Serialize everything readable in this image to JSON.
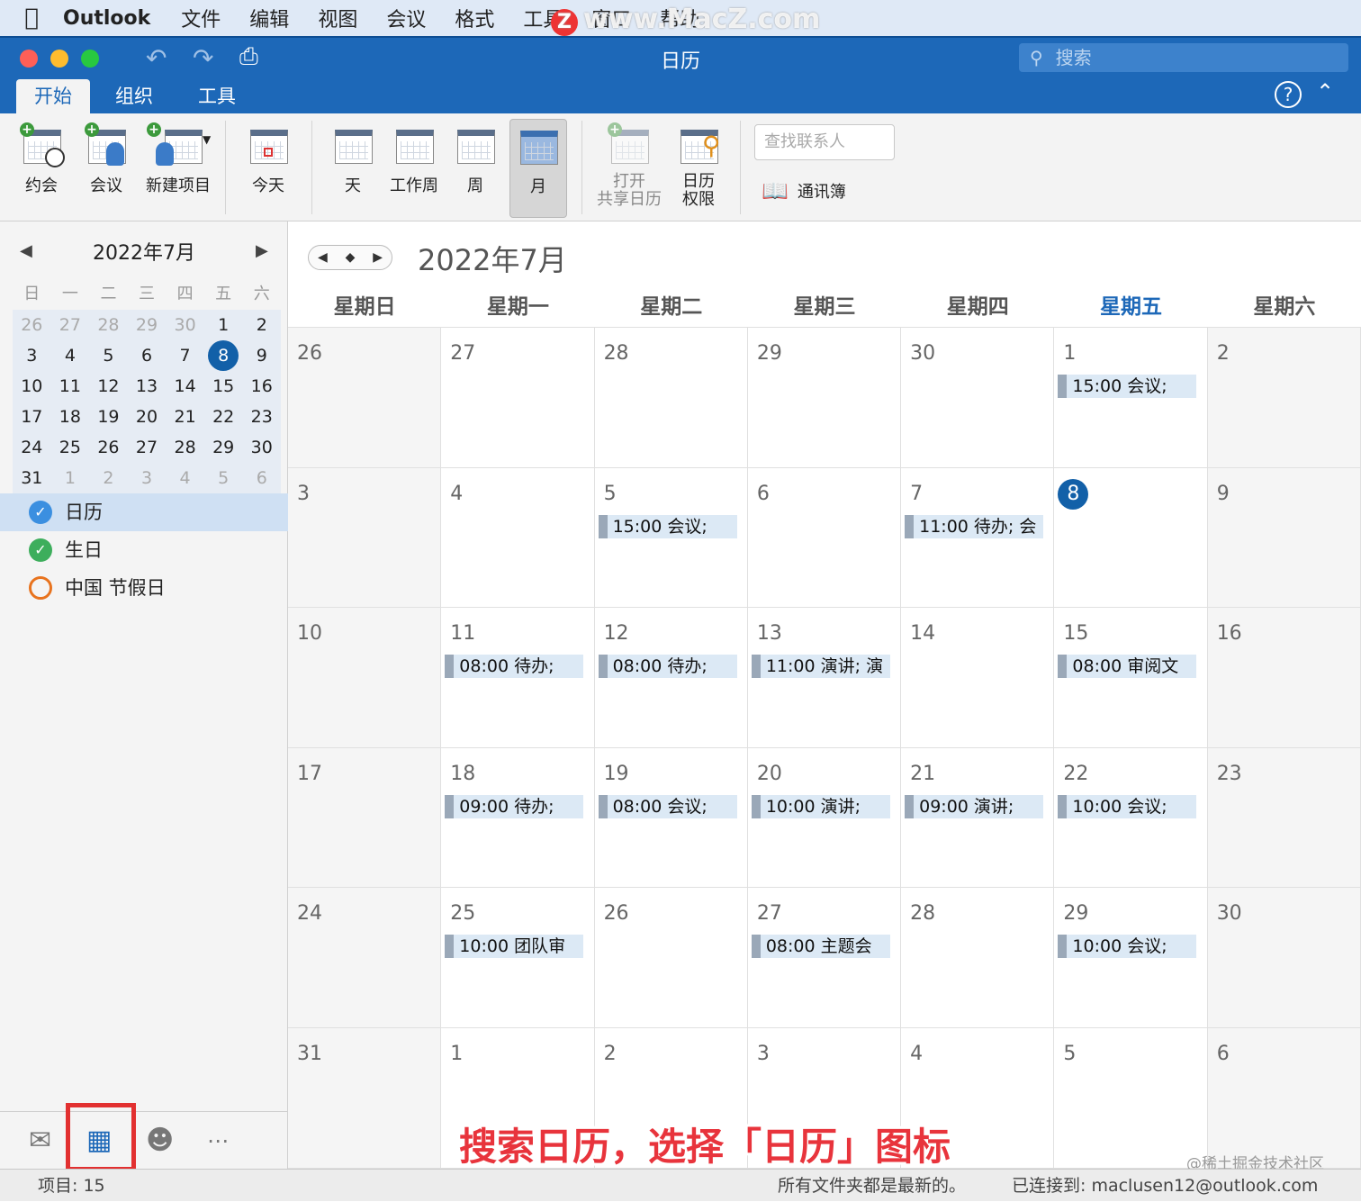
{
  "menubar": {
    "apple_icon": "apple-icon",
    "app_name": "Outlook",
    "items": [
      "文件",
      "编辑",
      "视图",
      "会议",
      "格式",
      "工具",
      "窗口",
      "帮助"
    ]
  },
  "watermark": {
    "z": "Z",
    "text": "www.MacZ.com"
  },
  "window": {
    "title": "日历",
    "search_placeholder": "搜索"
  },
  "tabs": [
    "开始",
    "组织",
    "工具"
  ],
  "ribbon": {
    "appointment": "约会",
    "meeting": "会议",
    "new_item": "新建项目",
    "today": "今天",
    "day": "天",
    "work_week": "工作周",
    "week": "周",
    "month": "月",
    "open_shared_1": "打开",
    "open_shared_2": "共享日历",
    "permissions_1": "日历",
    "permissions_2": "权限",
    "find_contact_placeholder": "查找联系人",
    "address_book": "通讯簿"
  },
  "mini_calendar": {
    "title": "2022年7月",
    "weekdays": [
      "日",
      "一",
      "二",
      "三",
      "四",
      "五",
      "六"
    ],
    "weeks": [
      [
        "26",
        "27",
        "28",
        "29",
        "30",
        "1",
        "2"
      ],
      [
        "3",
        "4",
        "5",
        "6",
        "7",
        "8",
        "9"
      ],
      [
        "10",
        "11",
        "12",
        "13",
        "14",
        "15",
        "16"
      ],
      [
        "17",
        "18",
        "19",
        "20",
        "21",
        "22",
        "23"
      ],
      [
        "24",
        "25",
        "26",
        "27",
        "28",
        "29",
        "30"
      ],
      [
        "31",
        "1",
        "2",
        "3",
        "4",
        "5",
        "6"
      ]
    ]
  },
  "calendars": [
    {
      "name": "日历",
      "color": "#3b8fe0",
      "checked": true
    },
    {
      "name": "生日",
      "color": "#3dae5c",
      "checked": true
    },
    {
      "name": "中国 节假日",
      "color": "#e8731e",
      "checked": false
    }
  ],
  "main": {
    "title": "2022年7月",
    "weekdays": [
      "星期日",
      "星期一",
      "星期二",
      "星期三",
      "星期四",
      "星期五",
      "星期六"
    ],
    "weeks": [
      [
        {
          "d": "26"
        },
        {
          "d": "27"
        },
        {
          "d": "28"
        },
        {
          "d": "29"
        },
        {
          "d": "30"
        },
        {
          "d": "1",
          "e": "15:00  会议;"
        },
        {
          "d": "2"
        }
      ],
      [
        {
          "d": "3"
        },
        {
          "d": "4"
        },
        {
          "d": "5",
          "e": "15:00  会议;"
        },
        {
          "d": "6"
        },
        {
          "d": "7",
          "e": "11:00  待办; 会"
        },
        {
          "d": "8"
        },
        {
          "d": "9"
        }
      ],
      [
        {
          "d": "10"
        },
        {
          "d": "11",
          "e": "08:00  待办;"
        },
        {
          "d": "12",
          "e": "08:00  待办;"
        },
        {
          "d": "13",
          "e": "11:00  演讲; 演"
        },
        {
          "d": "14"
        },
        {
          "d": "15",
          "e": "08:00  审阅文"
        },
        {
          "d": "16"
        }
      ],
      [
        {
          "d": "17"
        },
        {
          "d": "18",
          "e": "09:00  待办;"
        },
        {
          "d": "19",
          "e": "08:00  会议;"
        },
        {
          "d": "20",
          "e": "10:00  演讲;"
        },
        {
          "d": "21",
          "e": "09:00  演讲;"
        },
        {
          "d": "22",
          "e": "10:00  会议;"
        },
        {
          "d": "23"
        }
      ],
      [
        {
          "d": "24"
        },
        {
          "d": "25",
          "e": "10:00  团队审"
        },
        {
          "d": "26"
        },
        {
          "d": "27",
          "e": "08:00  主题会"
        },
        {
          "d": "28"
        },
        {
          "d": "29",
          "e": "10:00  会议;"
        },
        {
          "d": "30"
        }
      ],
      [
        {
          "d": "31"
        },
        {
          "d": "1"
        },
        {
          "d": "2"
        },
        {
          "d": "3"
        },
        {
          "d": "4"
        },
        {
          "d": "5"
        },
        {
          "d": "6"
        }
      ]
    ]
  },
  "caption": "搜索日历，选择「日历」图标",
  "credit": "@稀土掘金技术社区",
  "status": {
    "items": "项目: 15",
    "sync": "所有文件夹都是最新的。",
    "connected": "已连接到: maclusen12@outlook.com"
  },
  "colors": {
    "accent": "#1d68b8",
    "today": "#1260a8",
    "highlight_box": "#e23030"
  }
}
